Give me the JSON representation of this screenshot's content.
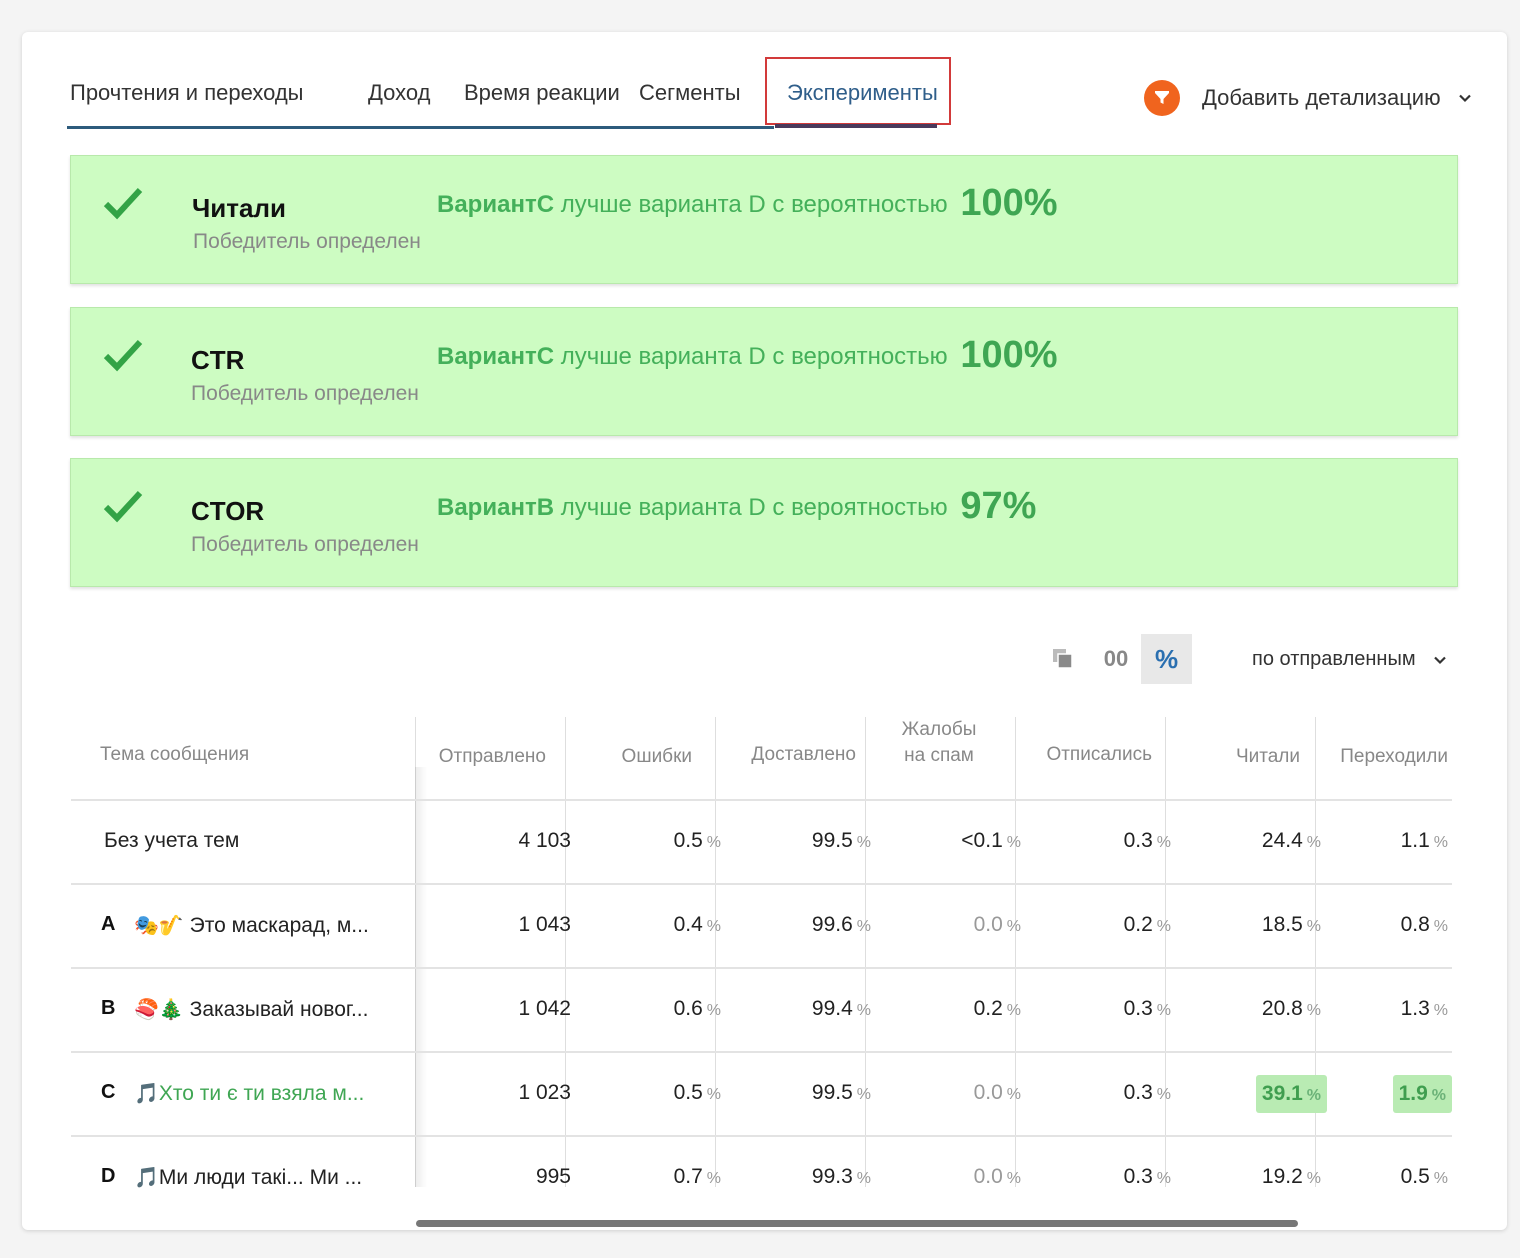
{
  "tabs": [
    {
      "label": "Прочтения и переходы"
    },
    {
      "label": "Доход"
    },
    {
      "label": "Время реакции"
    },
    {
      "label": "Сегменты"
    },
    {
      "label": "Эксперименты"
    }
  ],
  "active_tab": "Эксперименты",
  "detail_dropdown": {
    "label": "Добавить детализацию",
    "icon": "funnel-icon",
    "icon_color": "#f0641e"
  },
  "results": [
    {
      "metric": "Читали",
      "status": "Победитель определен",
      "variant_word": "ВариантC",
      "text": " лучше варианта D с вероятностью ",
      "probability": "100%"
    },
    {
      "metric": "CTR",
      "status": "Победитель определен",
      "variant_word": "ВариантC",
      "text": " лучше варианта D с вероятностью ",
      "probability": "100%"
    },
    {
      "metric": "CTOR",
      "status": "Победитель определен",
      "variant_word": "ВариантB",
      "text": " лучше варианта D с вероятностью ",
      "probability": "97%"
    }
  ],
  "toolbar": {
    "abs_label": "00",
    "pct_label": "%",
    "sort_label": "по отправленным"
  },
  "table": {
    "headers": {
      "subject": "Тема сообщения",
      "sent": "Отправлено",
      "errors": "Ошибки",
      "delivered": "Доставлено",
      "spam_line1": "Жалобы",
      "spam_line2": "на спам",
      "unsub": "Отписались",
      "read": "Читали",
      "clicked": "Переходили"
    },
    "unit": "%",
    "rows": [
      {
        "letter": "",
        "emoji": "",
        "subject": "Без учета тем",
        "sent": "4 103",
        "errors": "0.5",
        "delivered": "99.5",
        "spam": "<0.1",
        "unsub": "0.3",
        "read": "24.4",
        "clicked": "1.1"
      },
      {
        "letter": "A",
        "emoji": "🎭🎷",
        "subject": "Это маскарад, м...",
        "sent": "1 043",
        "errors": "0.4",
        "delivered": "99.6",
        "spam": "0.0",
        "unsub": "0.2",
        "read": "18.5",
        "clicked": "0.8"
      },
      {
        "letter": "B",
        "emoji": "🍣🎄",
        "subject": "Заказывай новог...",
        "sent": "1 042",
        "errors": "0.6",
        "delivered": "99.4",
        "spam": "0.2",
        "unsub": "0.3",
        "read": "20.8",
        "clicked": "1.3"
      },
      {
        "letter": "C",
        "emoji": "🎵",
        "subject": "Хто ти є ти взяла м...",
        "sent": "1 023",
        "errors": "0.5",
        "delivered": "99.5",
        "spam": "0.0",
        "unsub": "0.3",
        "read": "39.1",
        "clicked": "1.9"
      },
      {
        "letter": "D",
        "emoji": "🎵",
        "subject": "Ми люди такі... Ми ...",
        "sent": "995",
        "errors": "0.7",
        "delivered": "99.3",
        "spam": "0.0",
        "unsub": "0.3",
        "read": "19.2",
        "clicked": "0.5"
      }
    ]
  }
}
